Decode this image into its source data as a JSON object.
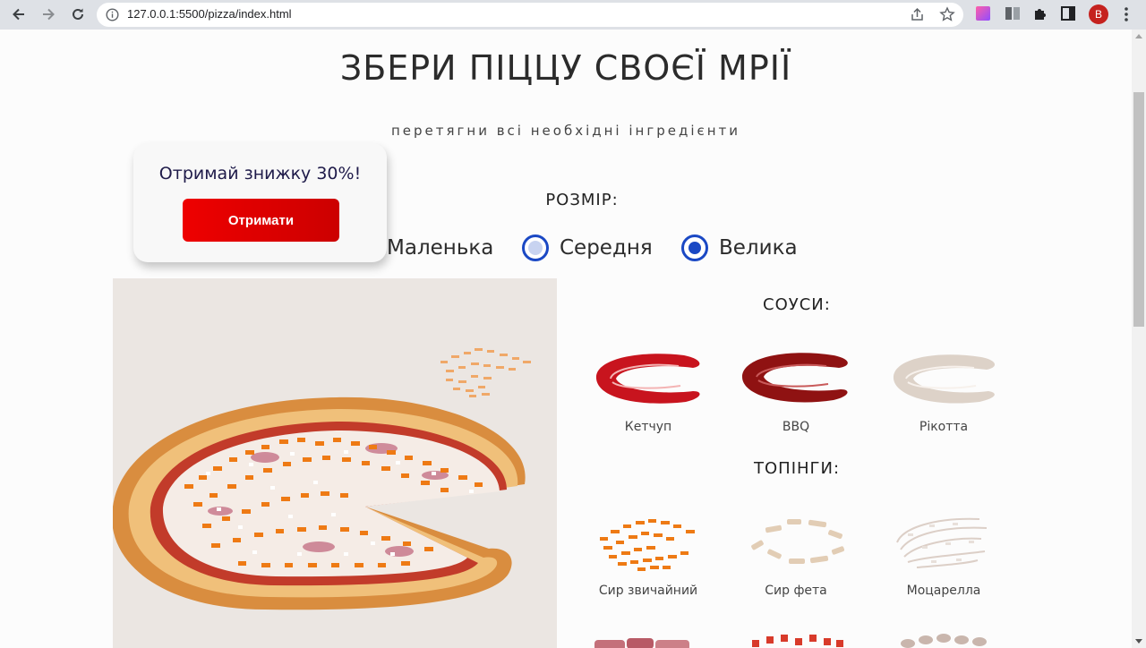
{
  "browser": {
    "url": "127.0.0.1:5500/pizza/index.html",
    "profile_initial": "B",
    "icons": [
      "back-icon",
      "forward-icon",
      "reload-icon",
      "info-icon",
      "share-icon",
      "star-icon",
      "extension-color-icon",
      "extension-tile-icon",
      "puzzle-icon",
      "side-panel-icon",
      "menu-icon"
    ]
  },
  "page": {
    "title": "ЗБЕРИ ПІЦЦУ СВОЄЇ МРІЇ",
    "subtitle": "перетягни всі необхідні інгредієнти"
  },
  "promo": {
    "text": "Отримай знижку 30%!",
    "button_label": "Отримати"
  },
  "size": {
    "label": "РОЗМІР:",
    "options": [
      {
        "label": "Маленька",
        "selected": false
      },
      {
        "label": "Середня",
        "selected": false
      },
      {
        "label": "Велика",
        "selected": true
      }
    ]
  },
  "sauces": {
    "label": "СОУСИ:",
    "items": [
      {
        "name": "Кетчуп",
        "color": "#c8141e"
      },
      {
        "name": "BBQ",
        "color": "#8f1212"
      },
      {
        "name": "Рікотта",
        "color": "#ddd2c8"
      }
    ]
  },
  "toppings": {
    "label": "ТОПІНГИ:",
    "items": [
      {
        "name": "Сир звичайний",
        "color": "#ee7a14"
      },
      {
        "name": "Сир фета",
        "color": "#e2cdb5"
      },
      {
        "name": "Моцарелла",
        "color": "#e4dcd6"
      }
    ]
  },
  "colors": {
    "accent_blue": "#1a48c4",
    "promo_red": "#ee0000"
  }
}
